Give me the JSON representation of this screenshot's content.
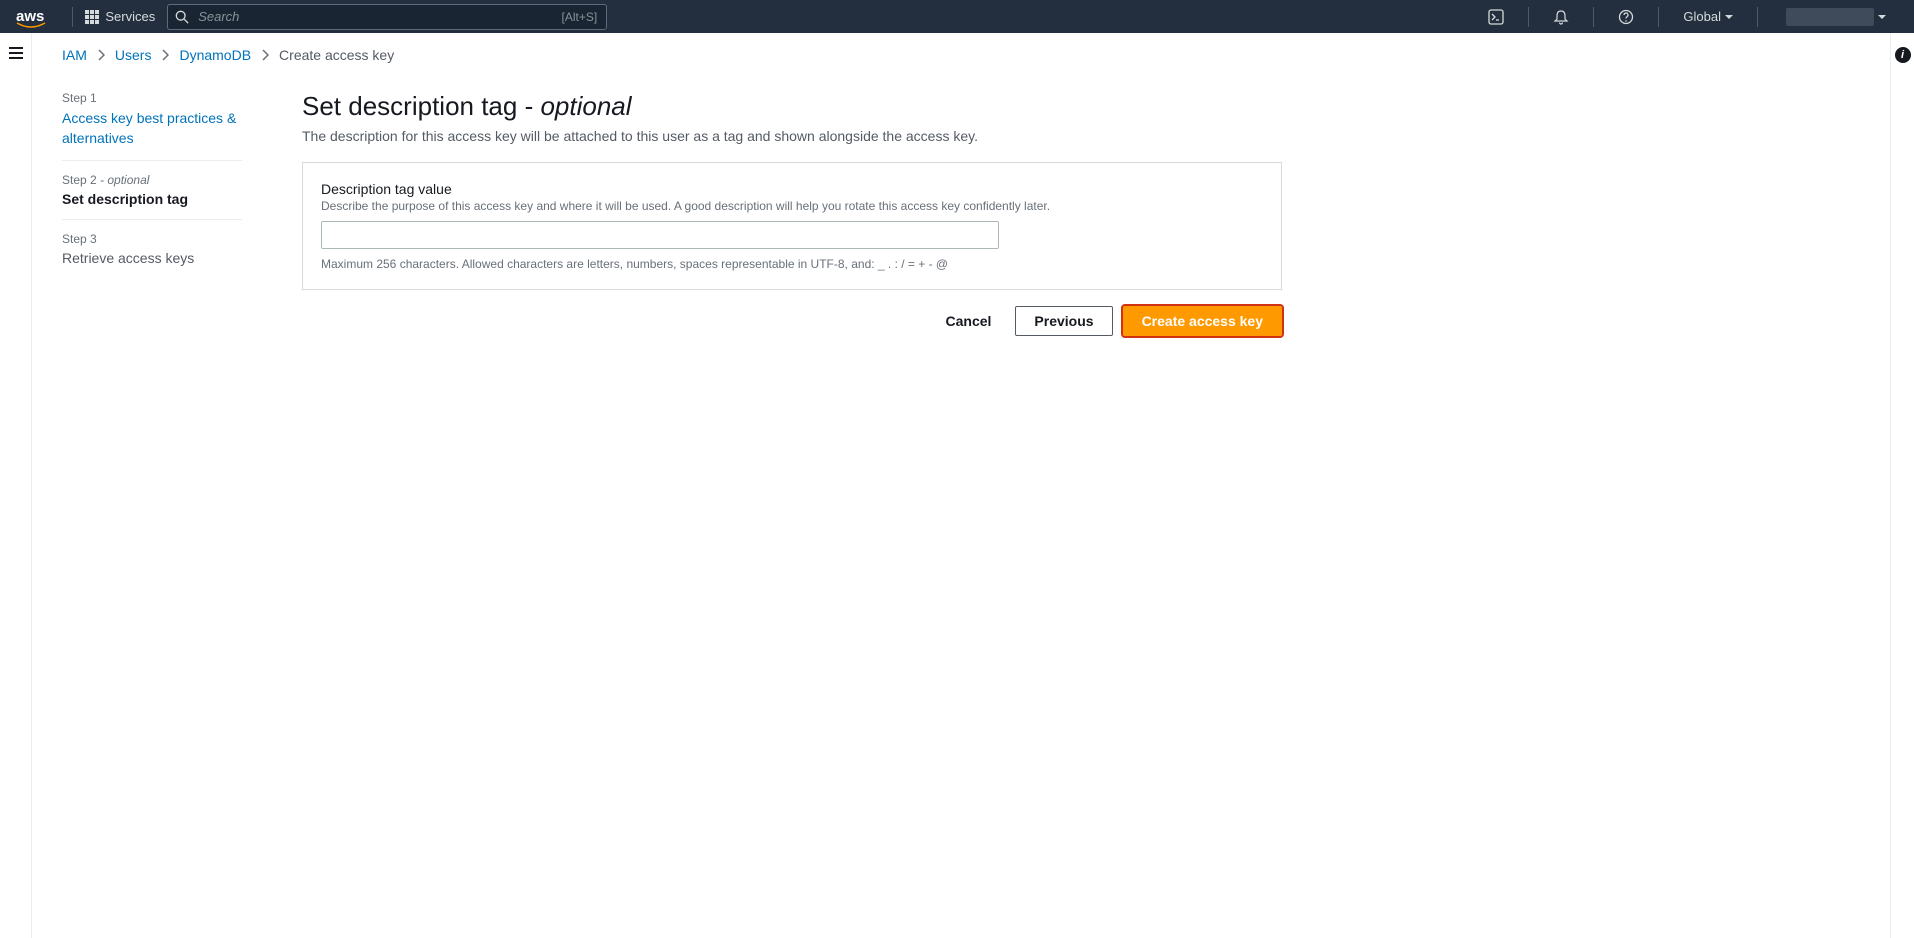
{
  "topnav": {
    "logo_text": "aws",
    "services_label": "Services",
    "search_placeholder": "Search",
    "search_hint": "[Alt+S]",
    "region_label": "Global"
  },
  "breadcrumbs": {
    "items": [
      "IAM",
      "Users",
      "DynamoDB"
    ],
    "current": "Create access key"
  },
  "wizard": {
    "steps": [
      {
        "label": "Step 1",
        "title": "Access key best practices & alternatives"
      },
      {
        "label": "Step 2",
        "label_suffix": " - optional",
        "title": "Set description tag"
      },
      {
        "label": "Step 3",
        "title": "Retrieve access keys"
      }
    ]
  },
  "page": {
    "title_main": "Set description tag",
    "title_sep": " - ",
    "title_suffix": "optional",
    "description": "The description for this access key will be attached to this user as a tag and shown alongside the access key."
  },
  "form": {
    "field_label": "Description tag value",
    "field_hint": "Describe the purpose of this access key and where it will be used. A good description will help you rotate this access key confidently later.",
    "field_value": "",
    "field_constraint": "Maximum 256 characters. Allowed characters are letters, numbers, spaces representable in UTF-8, and: _ . : / = + - @"
  },
  "actions": {
    "cancel": "Cancel",
    "previous": "Previous",
    "create": "Create access key"
  }
}
